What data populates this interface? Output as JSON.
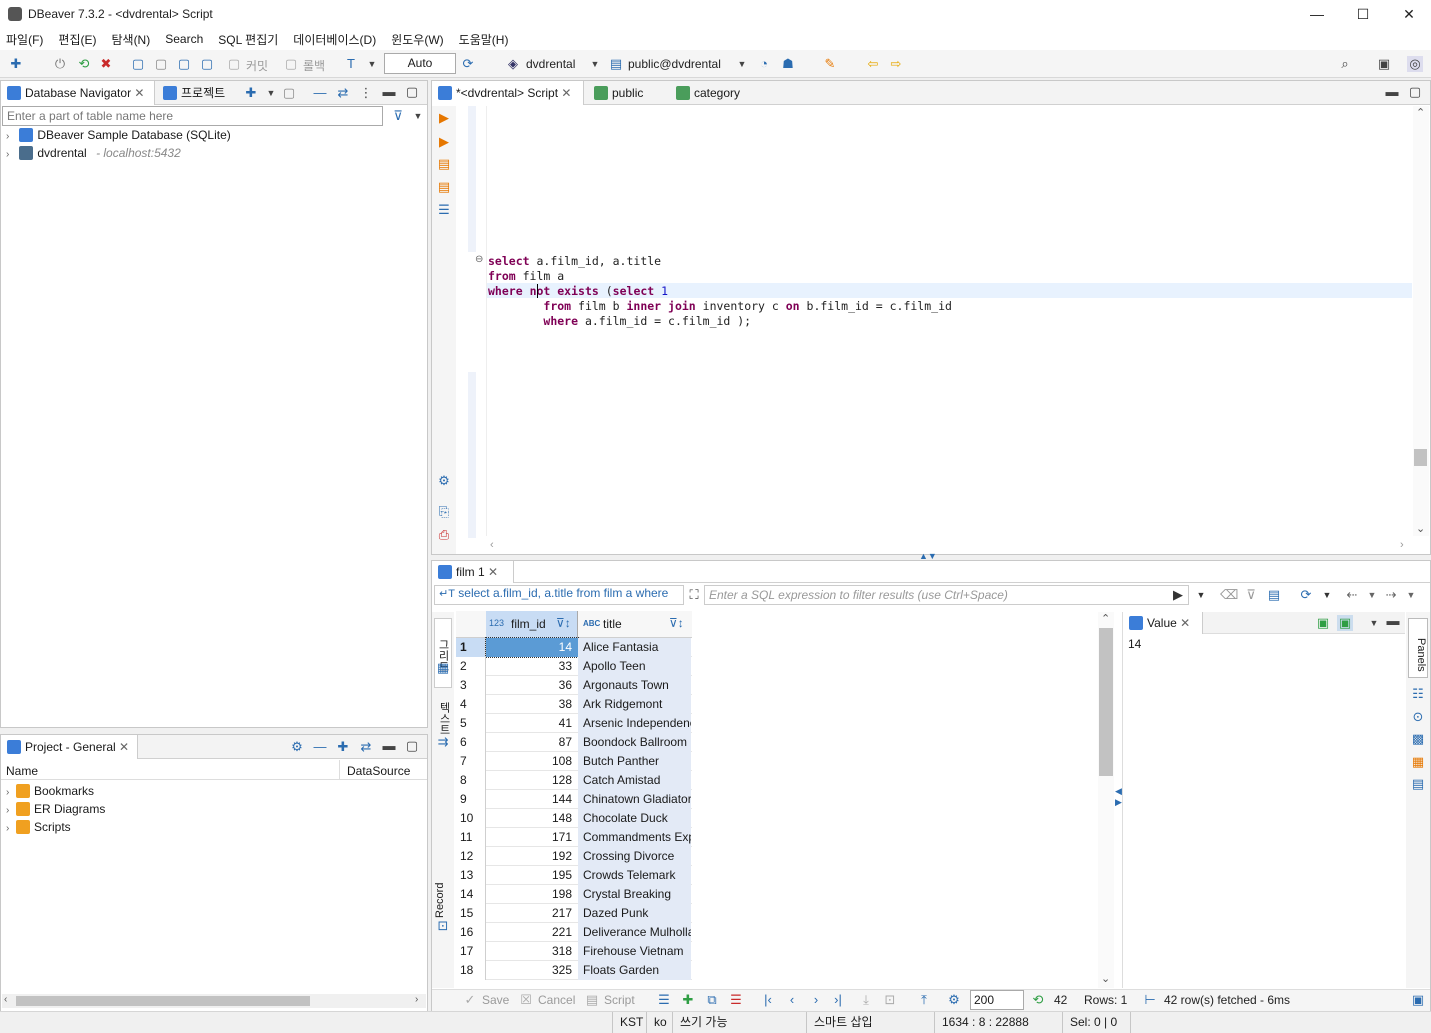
{
  "window": {
    "title": "DBeaver 7.3.2 - <dvdrental> Script",
    "minimize": "—",
    "maximize": "☐",
    "close": "✕"
  },
  "menu": [
    "파일(F)",
    "편집(E)",
    "탐색(N)",
    "Search",
    "SQL 편집기",
    "데이터베이스(D)",
    "윈도우(W)",
    "도움말(H)"
  ],
  "toolbar": {
    "commit": "커밋",
    "rollback": "롤백",
    "mode": "Auto",
    "datasource": "dvdrental",
    "schema": "public@dvdrental"
  },
  "navigator": {
    "tab_label": "Database Navigator",
    "projects_tab_label": "프로젝트",
    "filter_placeholder": "Enter a part of table name here",
    "items": [
      {
        "label": "DBeaver Sample Database (SQLite)",
        "detail": ""
      },
      {
        "label": "dvdrental",
        "detail": "- localhost:5432"
      }
    ]
  },
  "project": {
    "tab_label": "Project - General",
    "columns": [
      "Name",
      "DataSource"
    ],
    "items": [
      "Bookmarks",
      "ER Diagrams",
      "Scripts"
    ]
  },
  "editor": {
    "tabs": [
      "*<dvdrental> Script",
      "public",
      "category"
    ],
    "sql_lines": [
      [
        [
          "kw",
          "select"
        ],
        [
          "t",
          " a.film_id, a.title"
        ]
      ],
      [
        [
          "kw",
          "from"
        ],
        [
          "t",
          " film a"
        ]
      ],
      [
        [
          "kw",
          "where"
        ],
        [
          "t",
          " "
        ],
        [
          "kw",
          "not exists"
        ],
        [
          "t",
          " ("
        ],
        [
          "kw",
          "select"
        ],
        [
          "t",
          " "
        ],
        [
          "num",
          "1"
        ]
      ],
      [
        [
          "t",
          "        "
        ],
        [
          "kw",
          "from"
        ],
        [
          "t",
          " film b "
        ],
        [
          "kw",
          "inner join"
        ],
        [
          "t",
          " inventory c "
        ],
        [
          "kw",
          "on"
        ],
        [
          "t",
          " b.film_id = c.film_id"
        ]
      ],
      [
        [
          "t",
          "        "
        ],
        [
          "kw",
          "where"
        ],
        [
          "t",
          " a.film_id = c.film_id );"
        ]
      ]
    ]
  },
  "results": {
    "tab_label": "film 1",
    "query_preview": "select a.film_id, a.title from film a where",
    "filter_placeholder": "Enter a SQL expression to filter results (use Ctrl+Space)",
    "columns": [
      {
        "type_badge": "123",
        "name": "film_id"
      },
      {
        "type_badge": "ABC",
        "name": "title"
      }
    ],
    "rows": [
      [
        1,
        14,
        "Alice Fantasia"
      ],
      [
        2,
        33,
        "Apollo Teen"
      ],
      [
        3,
        36,
        "Argonauts Town"
      ],
      [
        4,
        38,
        "Ark Ridgemont"
      ],
      [
        5,
        41,
        "Arsenic Independence"
      ],
      [
        6,
        87,
        "Boondock Ballroom"
      ],
      [
        7,
        108,
        "Butch Panther"
      ],
      [
        8,
        128,
        "Catch Amistad"
      ],
      [
        9,
        144,
        "Chinatown Gladiator"
      ],
      [
        10,
        148,
        "Chocolate Duck"
      ],
      [
        11,
        171,
        "Commandments Express"
      ],
      [
        12,
        192,
        "Crossing Divorce"
      ],
      [
        13,
        195,
        "Crowds Telemark"
      ],
      [
        14,
        198,
        "Crystal Breaking"
      ],
      [
        15,
        217,
        "Dazed Punk"
      ],
      [
        16,
        221,
        "Deliverance Mulholland"
      ],
      [
        17,
        318,
        "Firehouse Vietnam"
      ],
      [
        18,
        325,
        "Floats Garden"
      ]
    ],
    "side_tabs": {
      "grid": "그리드",
      "text": "텍스트",
      "record": "Record",
      "panels": "Panels"
    },
    "value_panel": {
      "tab_label": "Value",
      "value": "14"
    },
    "bottom": {
      "save": "Save",
      "cancel": "Cancel",
      "script": "Script",
      "fetch_size": "200",
      "row_count": "42",
      "rows_label": "Rows: 1",
      "fetched": "42 row(s) fetched - 6ms"
    }
  },
  "statusbar": {
    "timezone": "KST",
    "locale": "ko",
    "mode": "쓰기 가능",
    "insert": "스마트 삽입",
    "cursor": "1634 : 8 : 22888",
    "selection": "Sel: 0 | 0"
  }
}
